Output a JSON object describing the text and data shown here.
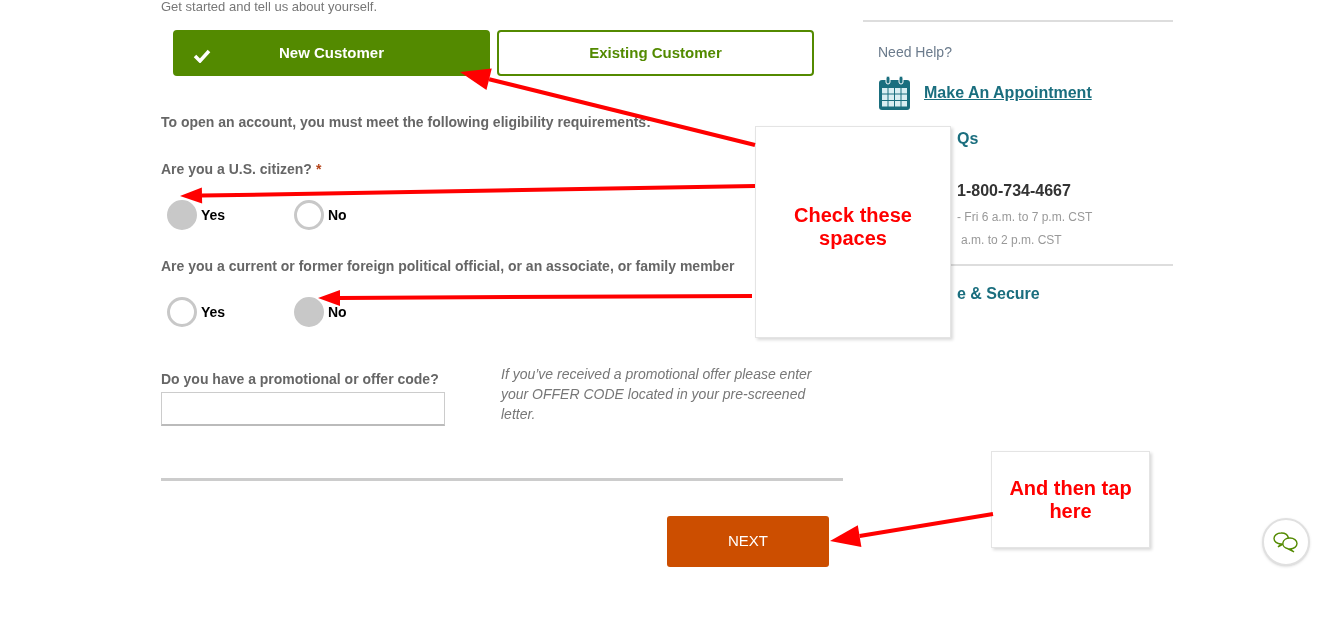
{
  "intro": "Get started and tell us about yourself.",
  "customer_tabs": [
    {
      "label": "New Customer",
      "selected": true
    },
    {
      "label": "Existing Customer",
      "selected": false
    }
  ],
  "eligibility_note": "To open an account, you must meet the following eligibility requirements:",
  "questions": [
    {
      "label": "Are you a U.S. citizen?",
      "required_mark": "*",
      "options": [
        {
          "label": "Yes",
          "selected": true
        },
        {
          "label": "No",
          "selected": false
        }
      ]
    },
    {
      "label": "Are you a current or former foreign political official, or an associate, or family member",
      "options": [
        {
          "label": "Yes",
          "selected": false
        },
        {
          "label": "No",
          "selected": true
        }
      ]
    }
  ],
  "promo": {
    "label": "Do you have a promotional or offer code?",
    "hint": "If you’ve received a promotional offer please enter your OFFER CODE located in your pre-screened letter."
  },
  "next_button": "NEXT",
  "sidebar": {
    "heading": "Need Help?",
    "appointment_link": "Make An Appointment",
    "faqs_fragment": "Qs",
    "phone": "1-800-734-4667",
    "hours": [
      "- Fri 6 a.m. to 7 p.m. CST",
      "a.m. to 2 p.m. CST"
    ],
    "secure_fragment": "e & Secure"
  },
  "callouts": [
    "Check these spaces",
    "And then tap here"
  ]
}
